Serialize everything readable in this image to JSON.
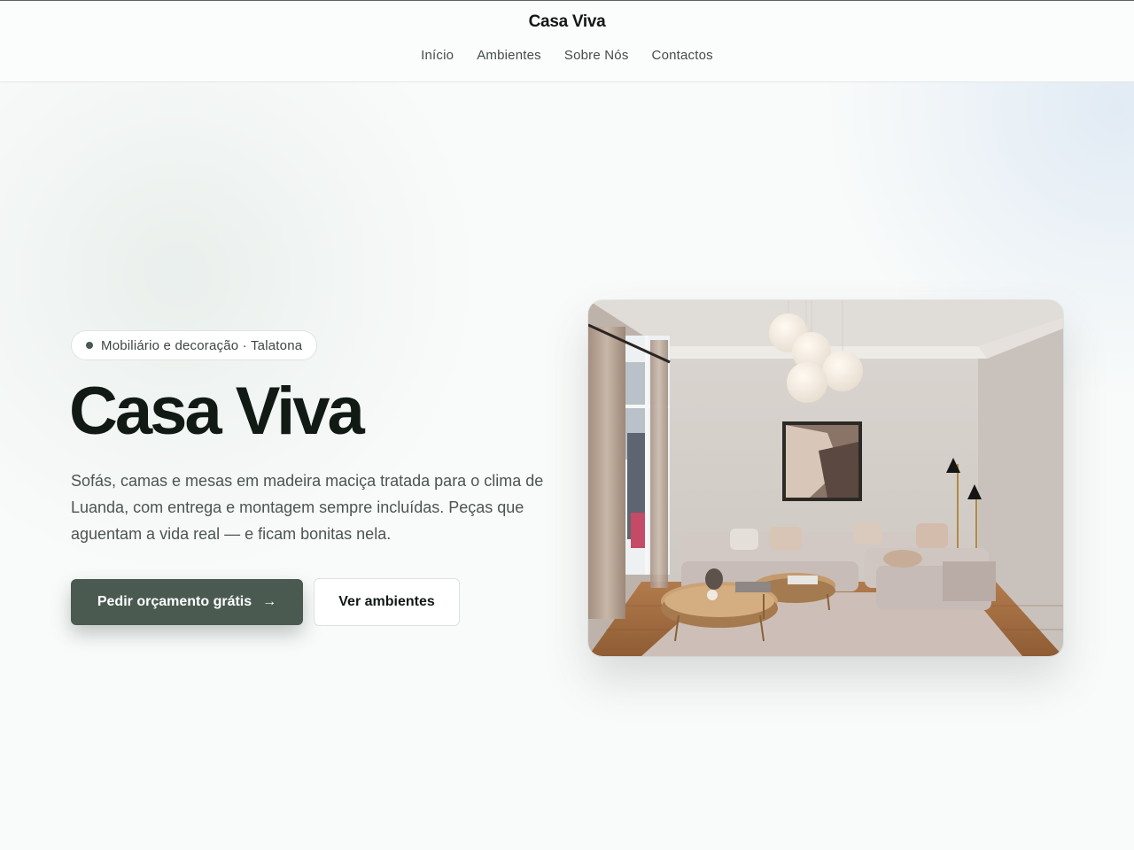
{
  "header": {
    "brand": "Casa Viva",
    "nav": [
      "Início",
      "Ambientes",
      "Sobre Nós",
      "Contactos"
    ]
  },
  "hero": {
    "badge": "Mobiliário e decoração · Talatona",
    "title": "Casa Viva",
    "lead": "Sofás, camas e mesas em madeira maciça tratada para o clima de Luanda, com entrega e montagem sempre incluídas. Peças que aguentam a vida real — e ficam bonitas nela.",
    "primary_button": "Pedir orçamento grátis",
    "primary_icon": "arrow-right-icon",
    "secondary_button": "Ver ambientes",
    "image_subject": "living-room-photo"
  },
  "colors": {
    "accent": "#4a5a51",
    "heading": "#111a15",
    "text": "#4c5550",
    "background": "#f9fbfa"
  }
}
